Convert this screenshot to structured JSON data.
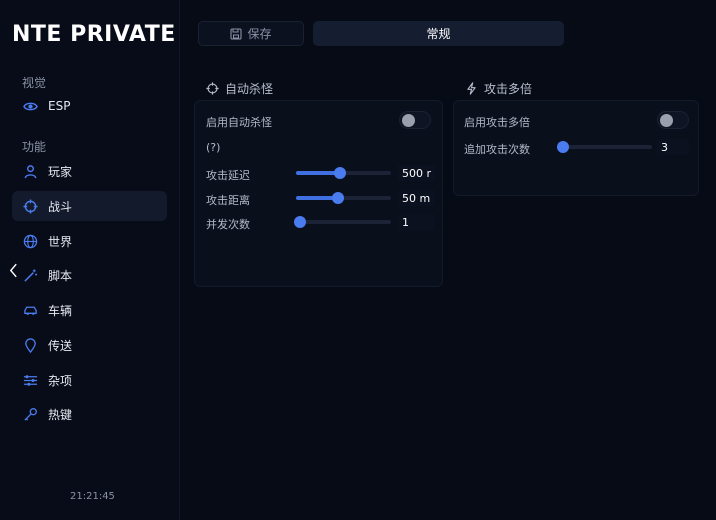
{
  "app": {
    "title": "NTE PRIVATE"
  },
  "sidebar": {
    "section_visual": "视觉",
    "section_features": "功能",
    "items": [
      {
        "label": "ESP",
        "icon": "eye-icon"
      },
      {
        "label": "玩家",
        "icon": "user-icon"
      },
      {
        "label": "战斗",
        "icon": "crosshair-icon"
      },
      {
        "label": "世界",
        "icon": "globe-icon"
      },
      {
        "label": "脚本",
        "icon": "magic-wand-icon"
      },
      {
        "label": "车辆",
        "icon": "car-icon"
      },
      {
        "label": "传送",
        "icon": "location-pin-icon"
      },
      {
        "label": "杂项",
        "icon": "sliders-icon"
      },
      {
        "label": "热键",
        "icon": "key-icon"
      }
    ],
    "clock": "21:21:45"
  },
  "toolbar": {
    "save_label": "保存",
    "general_label": "常规"
  },
  "auto_kill": {
    "title": "自动杀怪",
    "enable_label": "启用自动杀怪",
    "enable_on": false,
    "help": "(?)",
    "delay": {
      "label": "攻击延迟",
      "value_text": "500 r",
      "fraction": 0.46
    },
    "distance": {
      "label": "攻击距离",
      "value_text": "50 m",
      "fraction": 0.44
    },
    "concurrency": {
      "label": "并发次数",
      "value_text": "1",
      "fraction": 0.0
    }
  },
  "multi_attack": {
    "title": "攻击多倍",
    "enable_label": "启用攻击多倍",
    "enable_on": false,
    "extra": {
      "label": "追加攻击次数",
      "value_text": "3",
      "fraction": 0.06
    }
  },
  "colors": {
    "accent": "#4a7cf0",
    "background": "#070b16",
    "active_nav": "#121a2c"
  }
}
